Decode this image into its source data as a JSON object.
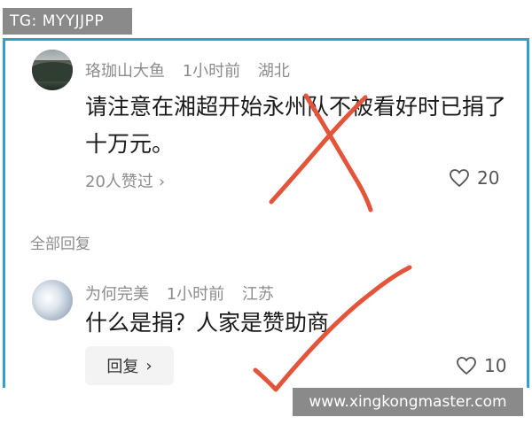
{
  "badge": {
    "text": "TG: MYYJJPP"
  },
  "comments": [
    {
      "user": "珞珈山大鱼",
      "time": "1小时前",
      "location": "湖北",
      "text": "请注意在湘超开始永州队不被看好时已捐了十万元。",
      "likes_summary": "20人赞过",
      "likes_summary_chevron": "›",
      "like_count": "20"
    },
    {
      "user": "为何完美",
      "time": "1小时前",
      "location": "江苏",
      "text": "什么是捐？人家是赞助商",
      "reply_label": "回复",
      "reply_chevron": "›",
      "like_count": "10"
    }
  ],
  "section": {
    "all_replies": "全部回复"
  },
  "marks": {
    "cross_color": "#e2553a",
    "check_color": "#e2553a"
  },
  "watermark": {
    "text": "www.xingkongmaster.com"
  },
  "icons": {
    "heart": "heart-icon",
    "chevron": "chevron-right-icon"
  }
}
